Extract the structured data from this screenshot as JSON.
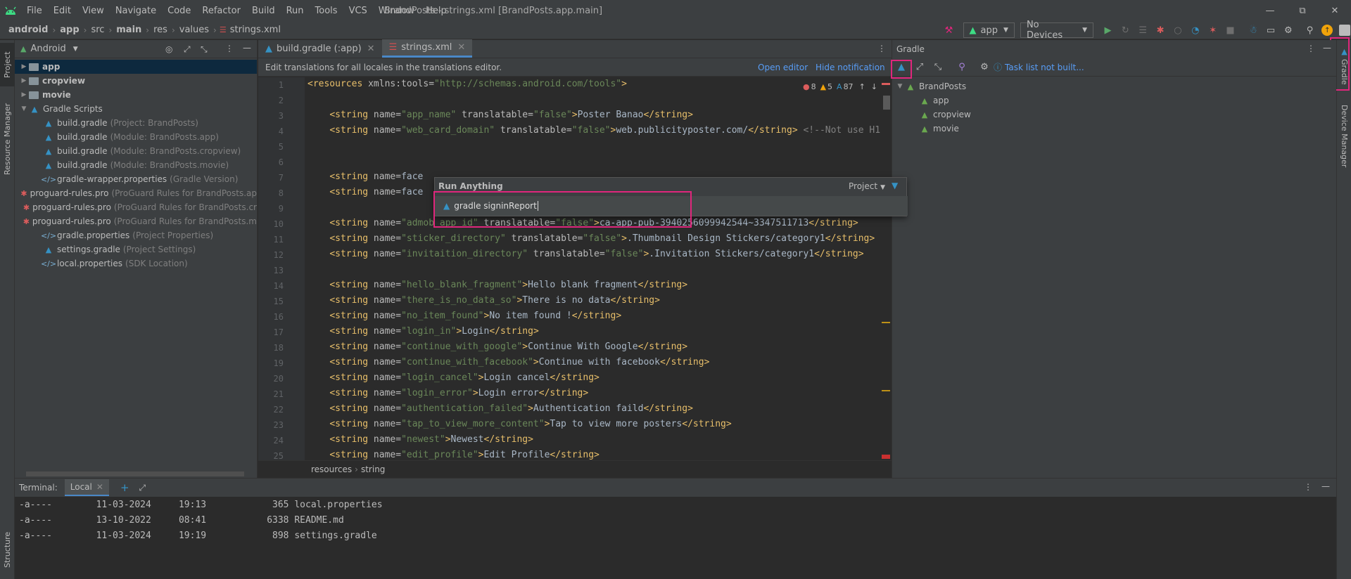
{
  "titlebar": {
    "menus": [
      "File",
      "Edit",
      "View",
      "Navigate",
      "Code",
      "Refactor",
      "Build",
      "Run",
      "Tools",
      "VCS",
      "Window",
      "Help"
    ],
    "title": "BrandPosts - strings.xml [BrandPosts.app.main]"
  },
  "navbar": {
    "crumbs": [
      "android",
      "app",
      "src",
      "main",
      "res",
      "values",
      "strings.xml"
    ],
    "run_config": "app",
    "device": "No Devices"
  },
  "side_left": {
    "project_tab": "Project",
    "resource_tab": "Resource Manager",
    "structure_tab": "Structure"
  },
  "side_right": {
    "gradle_tab": "Gradle",
    "device_tab": "Device Manager"
  },
  "project": {
    "view_mode": "Android",
    "items": [
      {
        "label": "app",
        "hint": ""
      },
      {
        "label": "cropview",
        "hint": ""
      },
      {
        "label": "movie",
        "hint": ""
      },
      {
        "label": "Gradle Scripts",
        "hint": ""
      },
      {
        "label": "build.gradle",
        "hint": "(Project: BrandPosts)"
      },
      {
        "label": "build.gradle",
        "hint": "(Module: BrandPosts.app)"
      },
      {
        "label": "build.gradle",
        "hint": "(Module: BrandPosts.cropview)"
      },
      {
        "label": "build.gradle",
        "hint": "(Module: BrandPosts.movie)"
      },
      {
        "label": "gradle-wrapper.properties",
        "hint": "(Gradle Version)"
      },
      {
        "label": "proguard-rules.pro",
        "hint": "(ProGuard Rules for BrandPosts.ap"
      },
      {
        "label": "proguard-rules.pro",
        "hint": "(ProGuard Rules for BrandPosts.cr"
      },
      {
        "label": "proguard-rules.pro",
        "hint": "(ProGuard Rules for BrandPosts.m"
      },
      {
        "label": "gradle.properties",
        "hint": "(Project Properties)"
      },
      {
        "label": "settings.gradle",
        "hint": "(Project Settings)"
      },
      {
        "label": "local.properties",
        "hint": "(SDK Location)"
      }
    ]
  },
  "editor": {
    "tabs": [
      "build.gradle (:app)",
      "strings.xml"
    ],
    "notification": "Edit translations for all locales in the translations editor.",
    "open_editor": "Open editor",
    "hide_notification": "Hide notification",
    "inspections": {
      "errors": "8",
      "warnings": "5",
      "typos": "87"
    },
    "line_numbers": [
      "1",
      "2",
      "3",
      "4",
      "5",
      "6",
      "7",
      "8",
      "9",
      "10",
      "11",
      "12",
      "13",
      "14",
      "15",
      "16",
      "17",
      "18",
      "19",
      "20",
      "21",
      "22",
      "23",
      "24",
      "25"
    ],
    "lines": [
      "<resources xmlns:tools=\"http://schemas.android.com/tools\">",
      "",
      "    <string name=\"app_name\" translatable=\"false\">Poster Banao</string>",
      "    <string name=\"web_card_domain\" translatable=\"false\">web.publicityposter.com/</string> <!--Not use H1",
      "",
      "",
      "    <string name=\"face",
      "    <string name=\"face",
      "",
      "    <string name=\"admob_app_id\" translatable=\"false\">ca-app-pub-3940256099942544~3347511713</string>",
      "    <string name=\"sticker_directory\" translatable=\"false\">.Thumbnail Design Stickers/category1</string>",
      "    <string name=\"invitaition_directory\" translatable=\"false\">.Invitation Stickers/category1</string>",
      "",
      "    <string name=\"hello_blank_fragment\">Hello blank fragment</string>",
      "    <string name=\"there_is_no_data_so\">There is no data</string>",
      "    <string name=\"no_item_found\">No item found !</string>",
      "    <string name=\"login_in\">Login</string>",
      "    <string name=\"continue_with_google\">Continue With Google</string>",
      "    <string name=\"continue_with_facebook\">Continue with facebook</string>",
      "    <string name=\"login_cancel\">Login cancel</string>",
      "    <string name=\"login_error\">Login error</string>",
      "    <string name=\"authentication_failed\">Authentication faild</string>",
      "    <string name=\"tap_to_view_more_content\">Tap to view more posters</string>",
      "    <string name=\"newest\">Newest</string>",
      "    <string name=\"edit_profile\">Edit Profile</string>"
    ],
    "breadcrumb": [
      "resources",
      "string"
    ]
  },
  "gradle": {
    "title": "Gradle",
    "task_list": "Task list not built...",
    "tree": [
      "BrandPosts",
      "app",
      "cropview",
      "movie"
    ]
  },
  "terminal": {
    "label": "Terminal:",
    "tab": "Local",
    "rows": [
      "-a----        11-03-2024     19:13            365 local.properties",
      "-a----        13-10-2022     08:41           6338 README.md",
      "-a----        11-03-2024     19:19            898 settings.gradle"
    ]
  },
  "run_anything": {
    "title": "Run Anything",
    "scope": "Project",
    "input": "gradle signinReport"
  },
  "colors": {
    "accent": "#e0267c",
    "selection": "#0d293e",
    "link": "#589df6",
    "gradle_green": "#6aa84f"
  }
}
